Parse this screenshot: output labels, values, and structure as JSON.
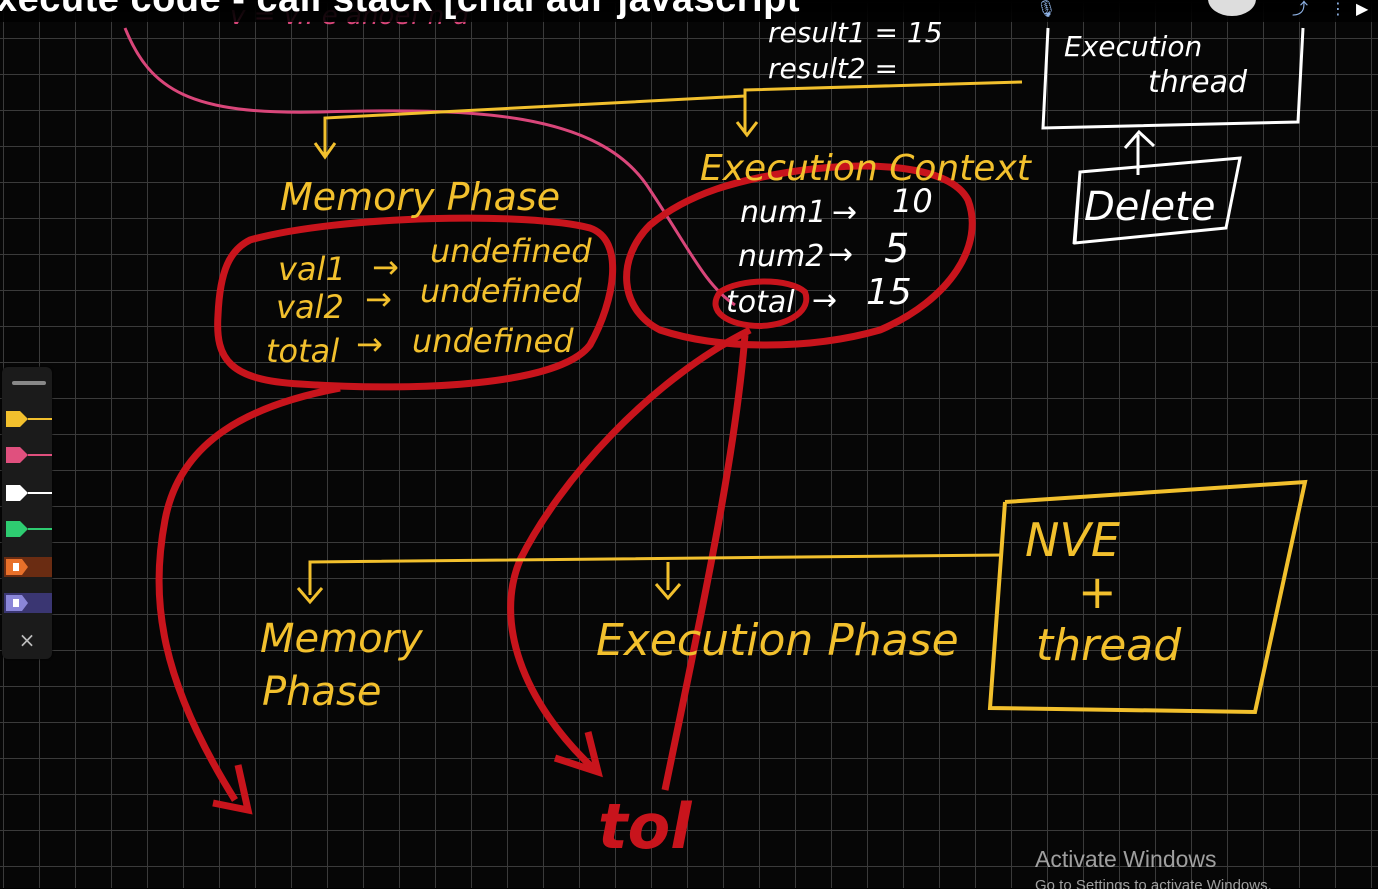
{
  "window": {
    "title": "xecute code - call stack [chai aur javascript"
  },
  "topbar": {
    "icons": [
      "microphone-icon",
      "avatar",
      "share-icon",
      "more-icon"
    ]
  },
  "board": {
    "top_left_fragment": "v = v.. e anoef n d",
    "code_lines": [
      "result1 = 15",
      "result2 ="
    ],
    "execution_thread_box": [
      "Execution",
      "thread"
    ],
    "delete_box": "Delete",
    "memory_phase_title": "Memory Phase",
    "memory_rows": [
      {
        "name": "val1",
        "arrow": "→",
        "value": "undefined"
      },
      {
        "name": "val2",
        "arrow": "→",
        "value": "undefined"
      },
      {
        "name": "total",
        "arrow": "→",
        "value": "undefined"
      }
    ],
    "execution_context_title": "Execution Context",
    "exec_rows": [
      {
        "name": "num1",
        "arrow": "→",
        "value": "10"
      },
      {
        "name": "num2",
        "arrow": "→",
        "value": "5"
      },
      {
        "name": "total",
        "arrow": "→",
        "value": "15"
      }
    ],
    "bottom_memory_phase": [
      "Memory",
      "Phase"
    ],
    "bottom_execution_phase": "Execution Phase",
    "nve_box": [
      "NVE",
      "+",
      "thread"
    ],
    "bottom_scribble": "tol"
  },
  "toolbar": {
    "pens": [
      {
        "name": "yellow-pen-icon",
        "color": "#f2c02d"
      },
      {
        "name": "pink-pen-icon",
        "color": "#e0507e"
      },
      {
        "name": "white-pen-icon",
        "color": "#ffffff"
      },
      {
        "name": "green-pen-icon",
        "color": "#2ecc71"
      },
      {
        "name": "orange-highlighter-icon",
        "color": "#e8702a"
      },
      {
        "name": "purple-highlighter-icon",
        "color": "#8a86d8"
      }
    ],
    "close_label": "×"
  },
  "watermark": {
    "line1": "Activate Windows",
    "line2": "Go to Settings to activate Windows."
  },
  "colors": {
    "background": "#060606",
    "grid": "#3a3a3a",
    "yellow": "#f2c02d",
    "red": "#c8141c",
    "pink": "#d9467a",
    "white": "#ffffff"
  }
}
